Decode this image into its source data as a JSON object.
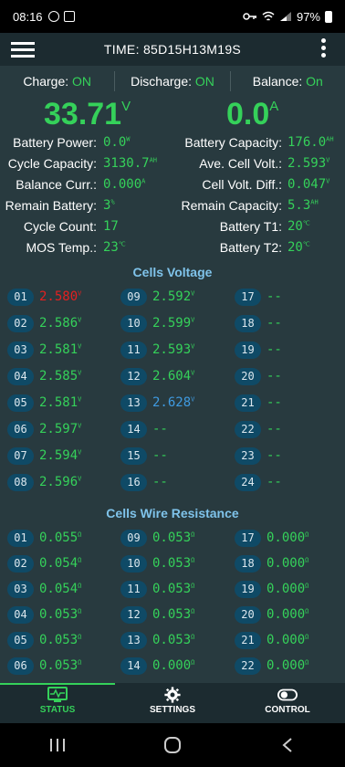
{
  "statusbar": {
    "time": "08:16",
    "battery": "97%"
  },
  "appbar": {
    "title": "TIME: 85D15H13M19S"
  },
  "switches": [
    {
      "label": "Charge: ",
      "state": "ON"
    },
    {
      "label": "Discharge: ",
      "state": "ON"
    },
    {
      "label": "Balance: ",
      "state": "On"
    }
  ],
  "big": {
    "voltage": "33.71",
    "voltage_unit": "V",
    "current": "0.0",
    "current_unit": "A"
  },
  "info": {
    "left": [
      {
        "label": "Battery Power:",
        "value": "0.0",
        "unit": "W"
      },
      {
        "label": "Cycle Capacity:",
        "value": "3130.7",
        "unit": "AH"
      },
      {
        "label": "Balance Curr.:",
        "value": "0.000",
        "unit": "A"
      },
      {
        "label": "Remain Battery:",
        "value": "3",
        "unit": "%"
      },
      {
        "label": "Cycle Count:",
        "value": "17",
        "unit": ""
      },
      {
        "label": "MOS Temp.:",
        "value": "23",
        "unit": "℃"
      }
    ],
    "right": [
      {
        "label": "Battery Capacity:",
        "value": "176.0",
        "unit": "AH"
      },
      {
        "label": "Ave. Cell Volt.:",
        "value": "2.593",
        "unit": "V"
      },
      {
        "label": "Cell Volt. Diff.:",
        "value": "0.047",
        "unit": "V"
      },
      {
        "label": "Remain Capacity:",
        "value": "5.3",
        "unit": "AH"
      },
      {
        "label": "Battery T1:",
        "value": "20",
        "unit": "℃"
      },
      {
        "label": "Battery T2:",
        "value": "20",
        "unit": "℃"
      }
    ]
  },
  "cells_voltage": {
    "title": "Cells Voltage",
    "cols": [
      [
        {
          "n": "01",
          "v": "2.580",
          "u": "V",
          "c": "red"
        },
        {
          "n": "02",
          "v": "2.586",
          "u": "V",
          "c": ""
        },
        {
          "n": "03",
          "v": "2.581",
          "u": "V",
          "c": ""
        },
        {
          "n": "04",
          "v": "2.585",
          "u": "V",
          "c": ""
        },
        {
          "n": "05",
          "v": "2.581",
          "u": "V",
          "c": ""
        },
        {
          "n": "06",
          "v": "2.597",
          "u": "V",
          "c": ""
        },
        {
          "n": "07",
          "v": "2.594",
          "u": "V",
          "c": ""
        },
        {
          "n": "08",
          "v": "2.596",
          "u": "V",
          "c": ""
        }
      ],
      [
        {
          "n": "09",
          "v": "2.592",
          "u": "V",
          "c": ""
        },
        {
          "n": "10",
          "v": "2.599",
          "u": "V",
          "c": ""
        },
        {
          "n": "11",
          "v": "2.593",
          "u": "V",
          "c": ""
        },
        {
          "n": "12",
          "v": "2.604",
          "u": "V",
          "c": ""
        },
        {
          "n": "13",
          "v": "2.628",
          "u": "V",
          "c": "blue"
        },
        {
          "n": "14",
          "v": "--",
          "u": "",
          "c": ""
        },
        {
          "n": "15",
          "v": "--",
          "u": "",
          "c": ""
        },
        {
          "n": "16",
          "v": "--",
          "u": "",
          "c": ""
        }
      ],
      [
        {
          "n": "17",
          "v": "--",
          "u": "",
          "c": ""
        },
        {
          "n": "18",
          "v": "--",
          "u": "",
          "c": ""
        },
        {
          "n": "19",
          "v": "--",
          "u": "",
          "c": ""
        },
        {
          "n": "20",
          "v": "--",
          "u": "",
          "c": ""
        },
        {
          "n": "21",
          "v": "--",
          "u": "",
          "c": ""
        },
        {
          "n": "22",
          "v": "--",
          "u": "",
          "c": ""
        },
        {
          "n": "23",
          "v": "--",
          "u": "",
          "c": ""
        },
        {
          "n": "24",
          "v": "--",
          "u": "",
          "c": ""
        }
      ]
    ]
  },
  "cells_resistance": {
    "title": "Cells Wire Resistance",
    "cols": [
      [
        {
          "n": "01",
          "v": "0.055",
          "u": "Ω"
        },
        {
          "n": "02",
          "v": "0.054",
          "u": "Ω"
        },
        {
          "n": "03",
          "v": "0.054",
          "u": "Ω"
        },
        {
          "n": "04",
          "v": "0.053",
          "u": "Ω"
        },
        {
          "n": "05",
          "v": "0.053",
          "u": "Ω"
        },
        {
          "n": "06",
          "v": "0.053",
          "u": "Ω"
        }
      ],
      [
        {
          "n": "09",
          "v": "0.053",
          "u": "Ω"
        },
        {
          "n": "10",
          "v": "0.053",
          "u": "Ω"
        },
        {
          "n": "11",
          "v": "0.053",
          "u": "Ω"
        },
        {
          "n": "12",
          "v": "0.053",
          "u": "Ω"
        },
        {
          "n": "13",
          "v": "0.053",
          "u": "Ω"
        },
        {
          "n": "14",
          "v": "0.000",
          "u": "Ω"
        }
      ],
      [
        {
          "n": "17",
          "v": "0.000",
          "u": "Ω"
        },
        {
          "n": "18",
          "v": "0.000",
          "u": "Ω"
        },
        {
          "n": "19",
          "v": "0.000",
          "u": "Ω"
        },
        {
          "n": "20",
          "v": "0.000",
          "u": "Ω"
        },
        {
          "n": "21",
          "v": "0.000",
          "u": "Ω"
        },
        {
          "n": "22",
          "v": "0.000",
          "u": "Ω"
        }
      ]
    ]
  },
  "tabs": [
    {
      "label": "STATUS",
      "icon": "monitor-icon",
      "active": true
    },
    {
      "label": "SETTINGS",
      "icon": "gear-icon",
      "active": false
    },
    {
      "label": "CONTROL",
      "icon": "toggle-icon",
      "active": false
    }
  ],
  "colors": {
    "accent": "#35d15a",
    "panel": "#283a3f",
    "bar": "#1c2b30",
    "title": "#7fc3ea",
    "pill": "#0f4a66",
    "alert_low": "#e32020",
    "alert_high": "#3f9ae0"
  }
}
